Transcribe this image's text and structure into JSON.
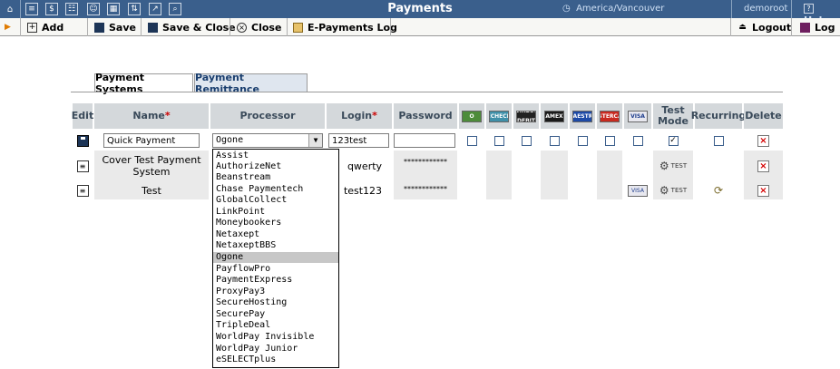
{
  "app": {
    "title": "Payments",
    "timezone": "America/Vancouver",
    "user": "demoroot",
    "help_label": "Help"
  },
  "toolbar": {
    "add_label": "Add",
    "save_label": "Save",
    "save_close_label": "Save & Close",
    "close_label": "Close",
    "epayments_log_label": "E-Payments Log",
    "logout_label": "Logout",
    "log_label": "Log"
  },
  "tabs": [
    {
      "label": "Payment Systems",
      "active": true
    },
    {
      "label": "Payment Remittance",
      "active": false
    }
  ],
  "table": {
    "headers": {
      "edit": "Edit",
      "name": "Name",
      "processor": "Processor",
      "login": "Login",
      "password": "Password",
      "test_mode_1": "Test",
      "test_mode_2": "Mode",
      "recurring": "Recurring",
      "delete": "Delete",
      "required_mark": "*"
    },
    "payment_method_icons": [
      "O",
      "ECHECK",
      "DIRECT DEBIT",
      "AMEX",
      "MAESTRO",
      "MASTERCARD",
      "VISA"
    ],
    "edit_row": {
      "name": "Quick Payment",
      "processor": "Ogone",
      "login": "123test",
      "password": "",
      "methods_checked": [
        false,
        false,
        false,
        false,
        false,
        false,
        false
      ],
      "test_mode": true,
      "recurring": false
    },
    "rows": [
      {
        "name_line1": "Cover Test Payment",
        "name_line2": "System",
        "login": "qwerty",
        "password": "************",
        "test_label": "TEST",
        "has_visa": false,
        "has_recurring": false
      },
      {
        "name_line1": "Test",
        "name_line2": "",
        "login": "test123",
        "password": "************",
        "test_label": "TEST",
        "has_visa": true,
        "has_recurring": true
      }
    ]
  },
  "processor_options": [
    "Assist",
    "AuthorizeNet",
    "Beanstream",
    "Chase Paymentech",
    "GlobalCollect",
    "LinkPoint",
    "Moneybookers",
    "Netaxept",
    "NetaxeptBBS",
    "Ogone",
    "PayflowPro",
    "PaymentExpress",
    "ProxyPay3",
    "SecureHosting",
    "SecurePay",
    "TripleDeal",
    "WorldPay Invisible",
    "WorldPay Junior",
    "eSELECTplus"
  ],
  "selected_processor": "Ogone",
  "colors": {
    "titlebar": "#3a5f8c",
    "header_bg": "#d4d8db",
    "row_shade": "#eaeaea",
    "delete_x": "#d40000",
    "required": "#cc0000"
  }
}
